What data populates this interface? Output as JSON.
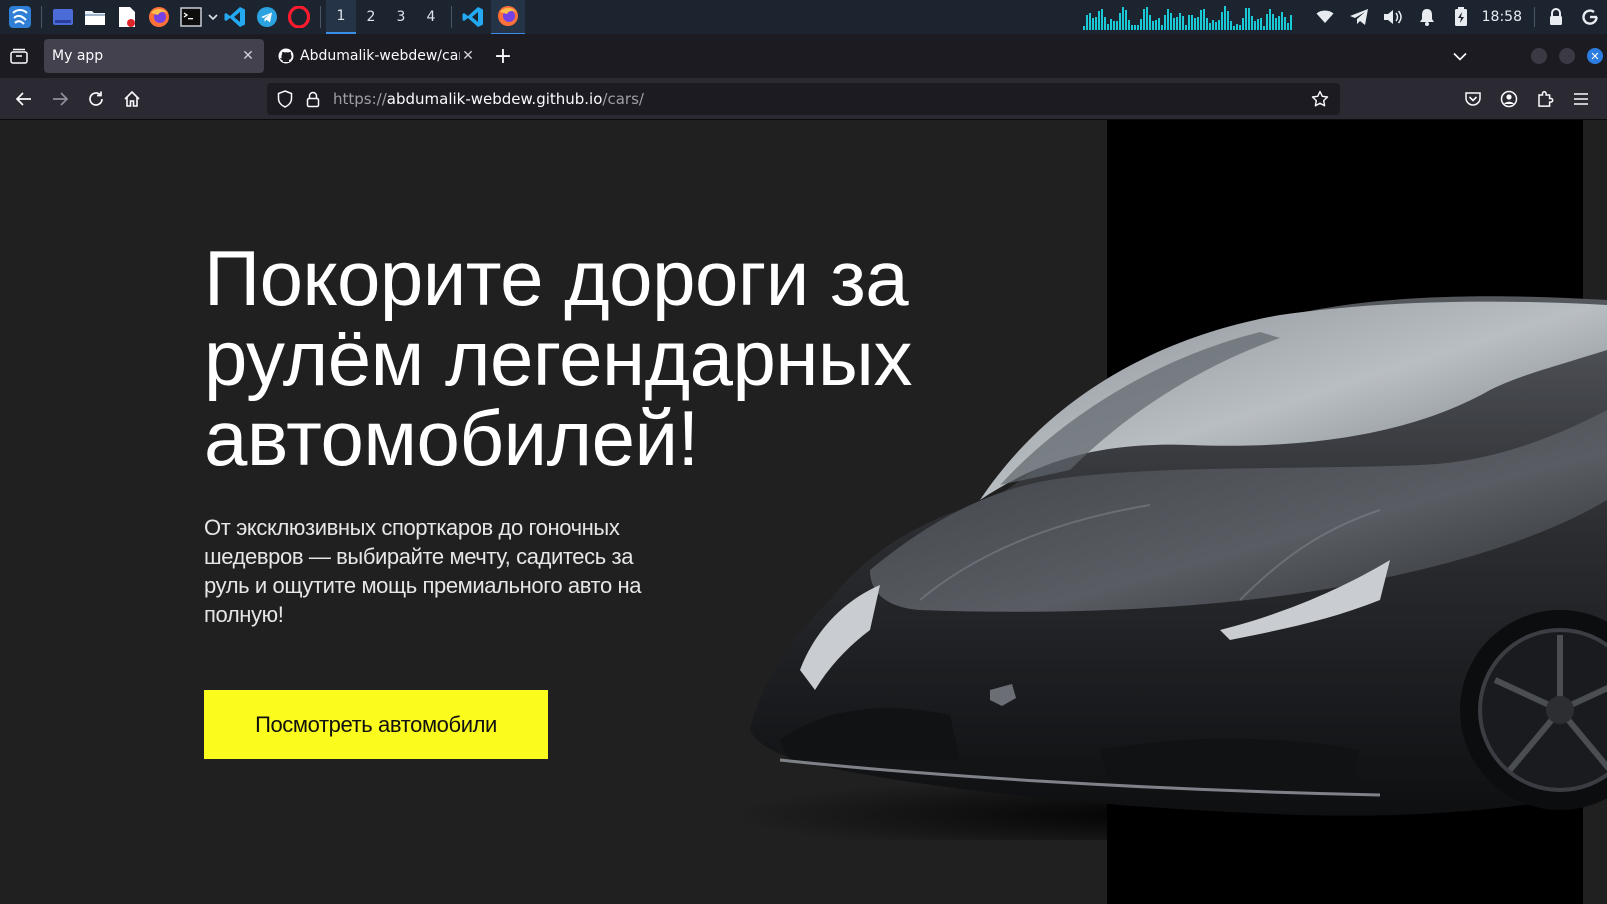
{
  "taskbar": {
    "workspaces": [
      "1",
      "2",
      "3",
      "4"
    ],
    "active_workspace": "1",
    "clock": "18:58",
    "accent": "#3a8ee6",
    "visualizer_color": "#19c9d6",
    "launcher_icons": [
      "app-menu-icon",
      "desktop-icon",
      "file-manager-icon",
      "text-editor-icon",
      "firefox-icon",
      "terminal-icon",
      "vscode-icon",
      "telegram-icon",
      "opera-icon"
    ],
    "tray_icons": [
      "wifi-icon",
      "telegram-tray-icon",
      "volume-icon",
      "notifications-icon",
      "battery-icon",
      "lock-icon",
      "power-icon"
    ]
  },
  "browser": {
    "tabs": [
      {
        "title": "My app",
        "active": true
      },
      {
        "title": "Abdumalik-webdew/cars",
        "active": false,
        "favicon": "github-icon"
      }
    ],
    "new_tab_label": "+",
    "url": {
      "scheme": "https://",
      "host": "abdumalik-webdew.github.io",
      "path": "/cars/"
    }
  },
  "page": {
    "hero": {
      "title": "Покорите дороги за рулём легендарных автомобилей!",
      "description": "От эксклюзивных спорткаров до гоночных шедевров — выбирайте мечту, садитесь за руль и ощутите мощь премиального авто на полную!",
      "cta_label": "Посмотреть автомобили",
      "cta_color": "#fbfb1e",
      "background": "#202020",
      "image_panel_color": "#000000"
    }
  }
}
